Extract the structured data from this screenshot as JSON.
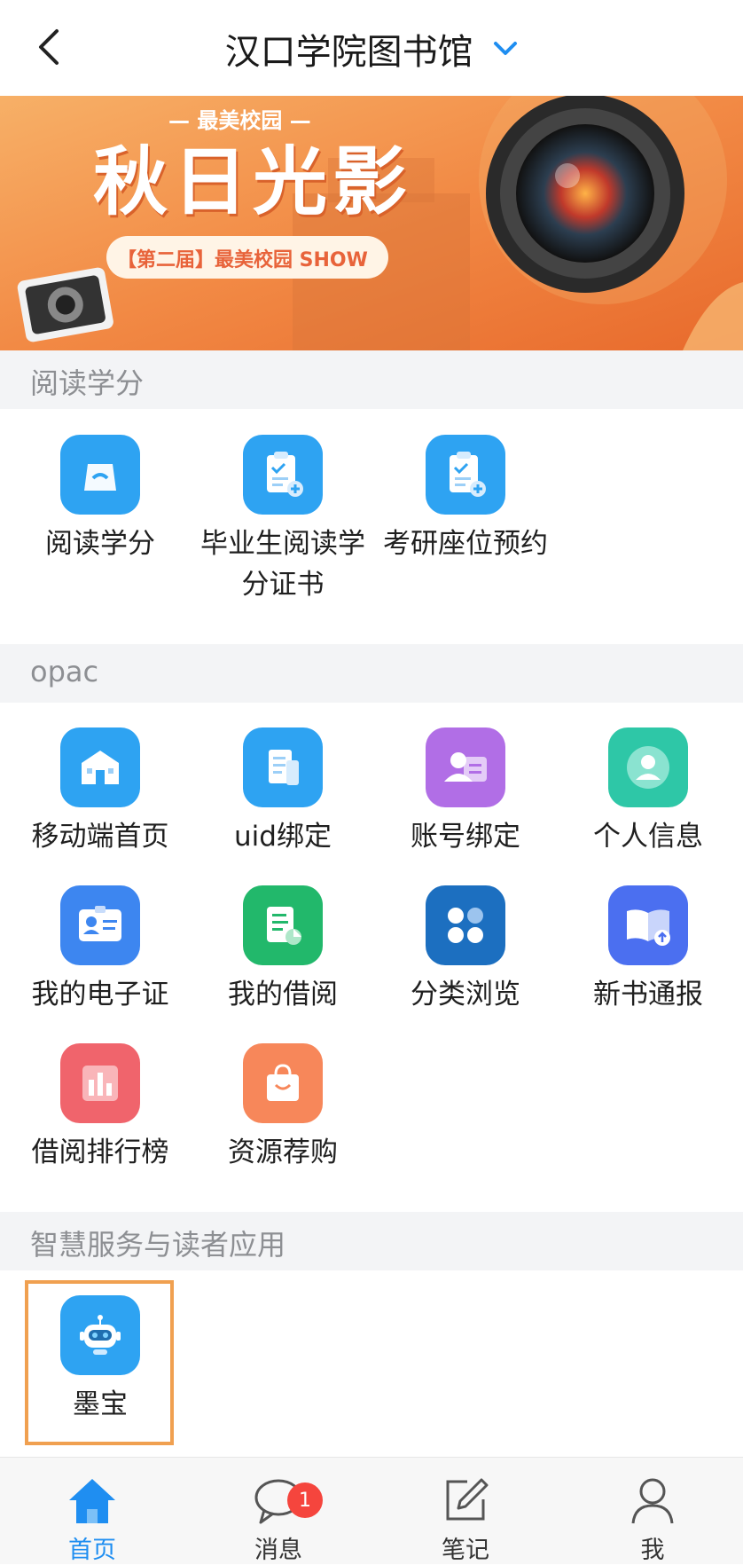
{
  "header": {
    "title": "汉口学院图书馆"
  },
  "banner": {
    "tagline": "— 最美校园 —",
    "headline": "秋日光影",
    "subline": "【第二届】最美校园 SHOW"
  },
  "sections": [
    {
      "title": "阅读学分",
      "items": [
        {
          "label": "阅读学分",
          "icon": "bag-icon",
          "color": "#2ea3f2"
        },
        {
          "label": "毕业生阅读学分证书",
          "icon": "clipboard-icon",
          "color": "#2ea3f2"
        },
        {
          "label": "考研座位预约",
          "icon": "clipboard-icon",
          "color": "#2ea3f2"
        }
      ]
    },
    {
      "title": "opac",
      "items": [
        {
          "label": "移动端首页",
          "icon": "building-icon",
          "color": "#2ea3f2"
        },
        {
          "label": "uid绑定",
          "icon": "document-icon",
          "color": "#2ea3f2"
        },
        {
          "label": "账号绑定",
          "icon": "id-card-icon",
          "color": "#b16ee6"
        },
        {
          "label": "个人信息",
          "icon": "user-icon",
          "color": "#2ec7a7"
        },
        {
          "label": "我的电子证",
          "icon": "badge-icon",
          "color": "#3d86f0"
        },
        {
          "label": "我的借阅",
          "icon": "report-icon",
          "color": "#22b86b"
        },
        {
          "label": "分类浏览",
          "icon": "grid-icon",
          "color": "#1c6fc0"
        },
        {
          "label": "新书通报",
          "icon": "book-icon",
          "color": "#4b6ff0"
        },
        {
          "label": "借阅排行榜",
          "icon": "bar-chart-icon",
          "color": "#f0646c"
        },
        {
          "label": "资源荐购",
          "icon": "shopping-bag-icon",
          "color": "#f7875a"
        }
      ]
    },
    {
      "title": "智慧服务与读者应用",
      "items": [
        {
          "label": "墨宝",
          "icon": "robot-icon",
          "color": "#2ea3f2"
        }
      ]
    }
  ],
  "tabbar": {
    "tabs": [
      {
        "label": "首页",
        "icon": "home-icon",
        "active": true
      },
      {
        "label": "消息",
        "icon": "chat-icon",
        "badge": "1"
      },
      {
        "label": "笔记",
        "icon": "edit-icon"
      },
      {
        "label": "我",
        "icon": "user-icon"
      }
    ]
  },
  "colors": {
    "accent": "#1f8ef1",
    "highlight_border": "#f0a050",
    "badge": "#f5453d"
  }
}
